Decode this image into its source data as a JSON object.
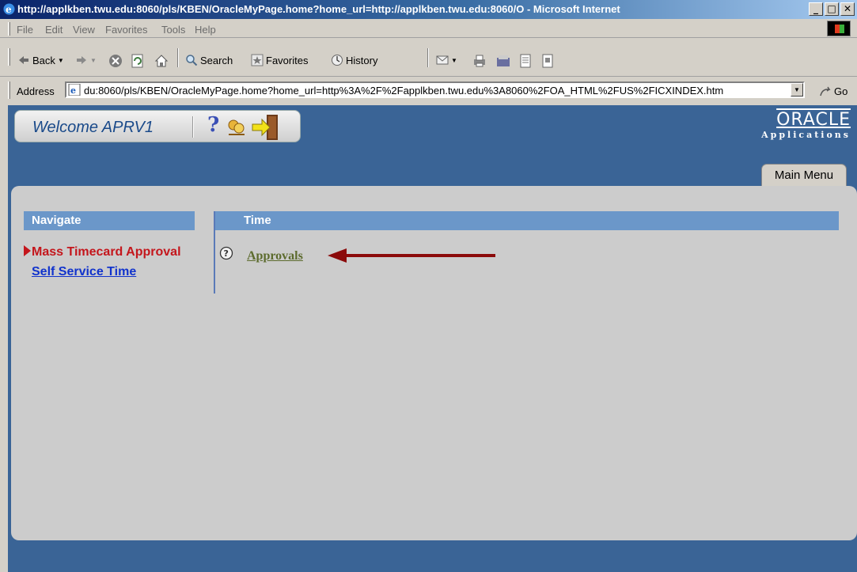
{
  "window": {
    "title": "http://applkben.twu.edu:8060/pls/KBEN/OracleMyPage.home?home_url=http://applkben.twu.edu:8060/O - Microsoft Internet",
    "controls": {
      "minimize": "_",
      "maximize": "□",
      "close": "✕"
    }
  },
  "menubar": {
    "items": [
      "File",
      "Edit",
      "View",
      "Favorites",
      "Tools",
      "Help"
    ]
  },
  "toolbar": {
    "back_label": "Back",
    "search_label": "Search",
    "favorites_label": "Favorites",
    "history_label": "History"
  },
  "address": {
    "label": "Address",
    "url": "du:8060/pls/KBEN/OracleMyPage.home?home_url=http%3A%2F%2Fapplkben.twu.edu%3A8060%2FOA_HTML%2FUS%2FICXINDEX.htm",
    "go_label": "Go"
  },
  "page": {
    "welcome_text": "Welcome APRV1",
    "help_glyph": "?",
    "logo_line1": "ORACLE",
    "logo_line2": "Applications",
    "main_menu_tab": "Main Menu",
    "navigate_header": "Navigate",
    "time_header": "Time",
    "nav_items": [
      "Mass Timecard Approval",
      "Self Service Time"
    ],
    "time_items": [
      "Approvals"
    ]
  },
  "colors": {
    "page_blue": "#3a6496",
    "header_blue": "#6b97c9",
    "active_red": "#c4161c",
    "link_blue": "#1133cc",
    "approvals_olive": "#5c6b2d",
    "arrow": "#8b0a0a"
  }
}
